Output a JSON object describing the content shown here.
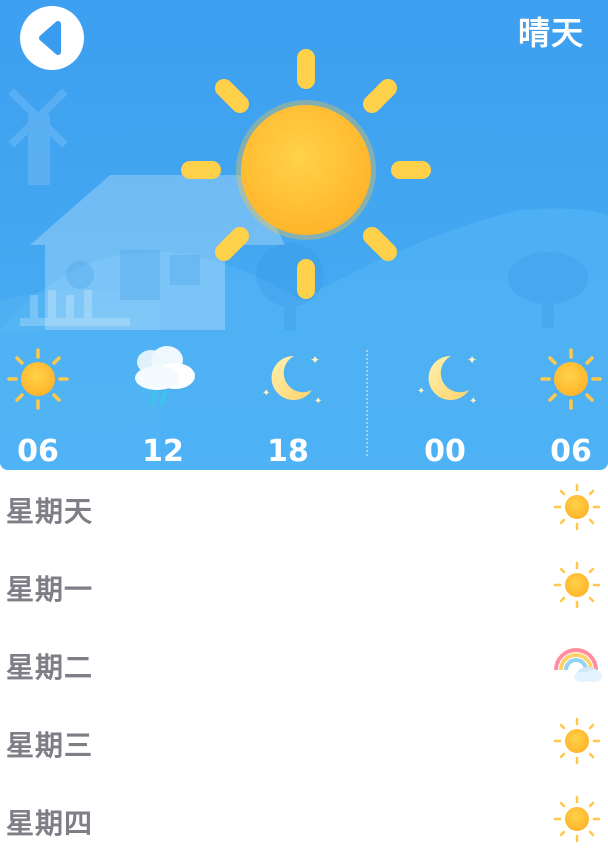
{
  "header": {
    "back_icon": "chevron-left-icon",
    "condition": "晴天",
    "main_icon": "sun-icon"
  },
  "hourly": [
    {
      "time": "06",
      "icon": "sun-icon"
    },
    {
      "time": "12",
      "icon": "rain-cloud-icon"
    },
    {
      "time": "18",
      "icon": "moon-icon"
    },
    {
      "time": "00",
      "icon": "moon-icon"
    },
    {
      "time": "06",
      "icon": "sun-icon"
    }
  ],
  "forecast": [
    {
      "day": "星期天",
      "icon": "sun-icon"
    },
    {
      "day": "星期一",
      "icon": "sun-icon"
    },
    {
      "day": "星期二",
      "icon": "rainbow-icon"
    },
    {
      "day": "星期三",
      "icon": "sun-icon"
    },
    {
      "day": "星期四",
      "icon": "sun-icon"
    }
  ],
  "colors": {
    "sky": "#42a6f1",
    "sun": "#ffc637",
    "sun_ray": "#ffd25a",
    "day_text": "#7e7e86"
  }
}
